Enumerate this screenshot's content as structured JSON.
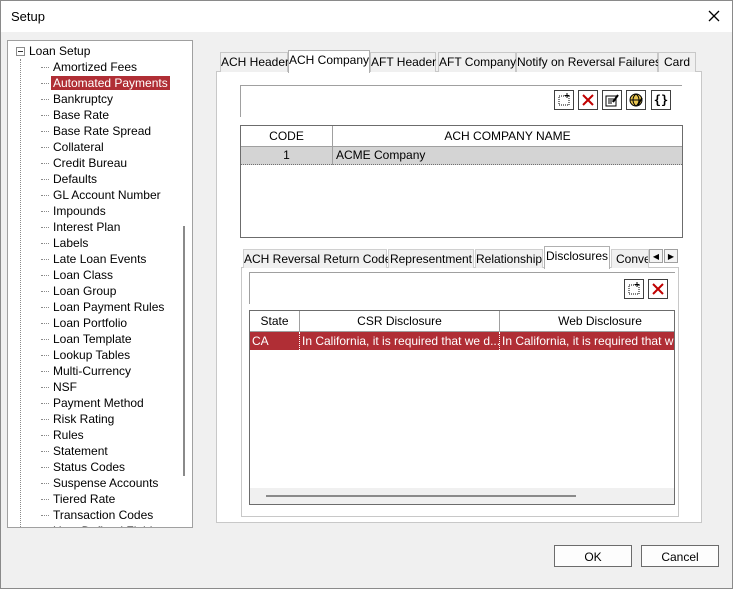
{
  "window": {
    "title": "Setup"
  },
  "tree": {
    "root_label": "Loan Setup",
    "items": [
      "Amortized Fees",
      "Automated Payments",
      "Bankruptcy",
      "Base Rate",
      "Base Rate Spread",
      "Collateral",
      "Credit Bureau",
      "Defaults",
      "GL Account Number",
      "Impounds",
      "Interest Plan",
      "Labels",
      "Late Loan Events",
      "Loan Class",
      "Loan Group",
      "Loan Payment Rules",
      "Loan Portfolio",
      "Loan Template",
      "Lookup Tables",
      "Multi-Currency",
      "NSF",
      "Payment Method",
      "Risk Rating",
      "Rules",
      "Statement",
      "Status Codes",
      "Suspense Accounts",
      "Tiered Rate",
      "Transaction Codes",
      "User Defined Fields"
    ],
    "selected": "Automated Payments"
  },
  "tabs": [
    "ACH Header",
    "ACH Company",
    "AFT Header",
    "AFT Company",
    "Notify on Reversal Failures",
    "Card"
  ],
  "active_tab": "ACH Company",
  "company_grid": {
    "columns": [
      "CODE",
      "ACH COMPANY NAME"
    ],
    "rows": [
      {
        "code": "1",
        "name": "ACME Company"
      }
    ]
  },
  "subtabs": [
    "ACH Reversal Return Codes",
    "Representment",
    "Relationship",
    "Disclosures",
    "Conve"
  ],
  "active_subtab": "Disclosures",
  "disclosure_grid": {
    "columns": [
      "State",
      "CSR Disclosure",
      "Web Disclosure"
    ],
    "rows": [
      {
        "state": "CA",
        "csr": "In California, it is required that we d...",
        "web": "In California, it is required that w"
      }
    ]
  },
  "buttons": {
    "ok": "OK",
    "cancel": "Cancel"
  },
  "colors": {
    "selection": "#b02e35"
  }
}
